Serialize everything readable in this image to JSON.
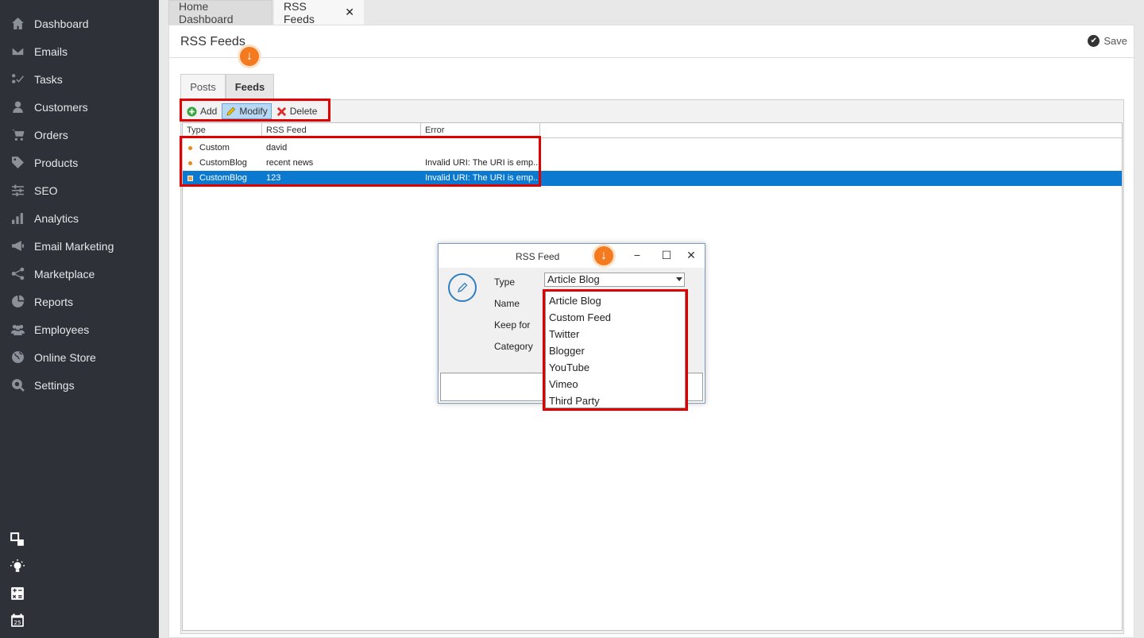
{
  "sidebar": {
    "items": [
      {
        "label": "Dashboard",
        "icon": "home-icon"
      },
      {
        "label": "Emails",
        "icon": "envelope-icon"
      },
      {
        "label": "Tasks",
        "icon": "tasks-icon"
      },
      {
        "label": "Customers",
        "icon": "user-icon"
      },
      {
        "label": "Orders",
        "icon": "cart-icon"
      },
      {
        "label": "Products",
        "icon": "tag-icon"
      },
      {
        "label": "SEO",
        "icon": "sliders-icon"
      },
      {
        "label": "Analytics",
        "icon": "bar-chart-icon"
      },
      {
        "label": "Email Marketing",
        "icon": "megaphone-icon"
      },
      {
        "label": "Marketplace",
        "icon": "share-icon"
      },
      {
        "label": "Reports",
        "icon": "pie-chart-icon"
      },
      {
        "label": "Employees",
        "icon": "users-icon"
      },
      {
        "label": "Online Store",
        "icon": "globe-icon"
      },
      {
        "label": "Settings",
        "icon": "gear-search-icon"
      }
    ],
    "bottom_icons": [
      "layout-icon",
      "lightbulb-icon",
      "calculator-icon",
      "calendar-icon"
    ],
    "calendar_day": "25"
  },
  "tabs": {
    "home": "Home Dashboard",
    "rss": "RSS Feeds",
    "close_glyph": "✕"
  },
  "header": {
    "title": "RSS Feeds",
    "save_label": "Save"
  },
  "subtabs": {
    "posts": "Posts",
    "feeds": "Feeds"
  },
  "toolbar": {
    "add": "Add",
    "modify": "Modify",
    "delete": "Delete"
  },
  "grid": {
    "columns": [
      "Type",
      "RSS Feed",
      "Error"
    ],
    "rows": [
      {
        "type": "Custom",
        "feed": "david",
        "error": ""
      },
      {
        "type": "CustomBlog",
        "feed": "recent news",
        "error": "Invalid URI: The URI is emp..."
      },
      {
        "type": "CustomBlog",
        "feed": "123",
        "error": "Invalid URI: The URI is emp..."
      }
    ]
  },
  "dialog": {
    "title": "RSS Feed",
    "labels": {
      "type": "Type",
      "name": "Name",
      "keep_for": "Keep for",
      "category": "Category"
    },
    "type_value": "Article Blog",
    "type_options": [
      "Article Blog",
      "Custom Feed",
      "Twitter",
      "Blogger",
      "YouTube",
      "Vimeo",
      "Third Party"
    ]
  },
  "colors": {
    "sidebar_bg": "#2e3138",
    "accent": "#f47a20",
    "highlight": "#e00000",
    "selected_row": "#0c79d0"
  }
}
